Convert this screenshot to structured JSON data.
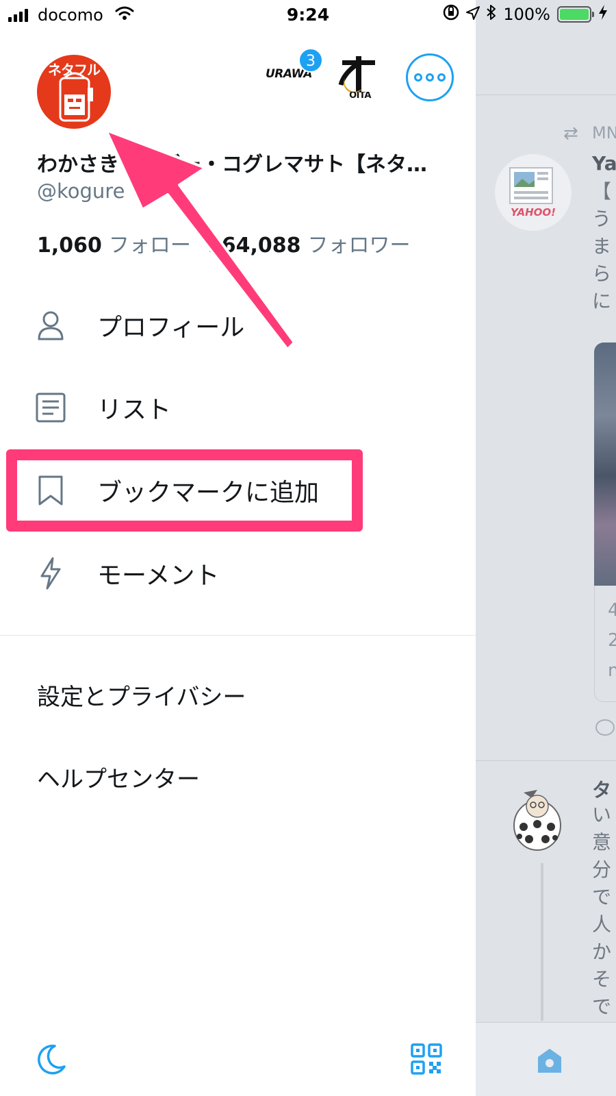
{
  "status_bar": {
    "carrier": "docomo",
    "time": "9:24",
    "battery": "100%"
  },
  "drawer": {
    "avatar_text": "ネタフル",
    "accounts": [
      {
        "label": "URAWA",
        "badge": "3"
      },
      {
        "label": "OITA"
      }
    ],
    "profile": {
      "name": "わかさきブロガー・コグレマサト【ネタ…",
      "handle": "@kogure",
      "following_count": "1,060",
      "following_label": "フォロー",
      "followers_count": "164,088",
      "followers_label": "フォロワー"
    },
    "menu": [
      {
        "label": "プロフィール",
        "icon": "person-icon"
      },
      {
        "label": "リスト",
        "icon": "list-icon"
      },
      {
        "label": "ブックマークに追加",
        "icon": "bookmark-icon"
      },
      {
        "label": "モーメント",
        "icon": "lightning-icon"
      }
    ],
    "settings_label": "設定とプライバシー",
    "help_label": "ヘルプセンター"
  },
  "timeline": {
    "retweeter": "MN",
    "tweet1_name": "Ya",
    "tweet1_lines": "【\nう\nま\nら\nに",
    "card_lines": [
      "4",
      "2",
      "n"
    ],
    "tweet2_name": "タ",
    "tweet2_lines": "い\n意\n分\nで\n人\nか\nそ\nで",
    "yahoo_label": "YAHOO!"
  },
  "colors": {
    "accent": "#1da1f2",
    "annotation": "#ff3b79",
    "avatar_bg": "#e5391b"
  }
}
